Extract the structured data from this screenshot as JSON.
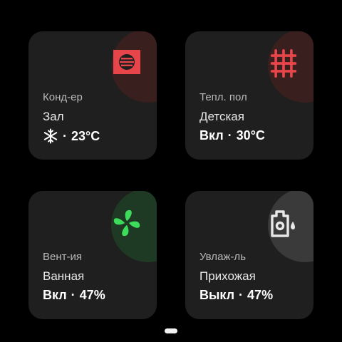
{
  "tiles": [
    {
      "type": "Конд-ер",
      "room": "Зал",
      "state_icon": "snowflake-icon",
      "separator": "·",
      "value": "23°C",
      "icon": "ac-unit-icon",
      "accent": "#e8454a"
    },
    {
      "type": "Тепл. пол",
      "room": "Детская",
      "state": "Вкл",
      "separator": "·",
      "value": "30°C",
      "icon": "floor-heating-icon",
      "accent": "#e8454a"
    },
    {
      "type": "Вент-ия",
      "room": "Ванная",
      "state": "Вкл",
      "separator": "·",
      "value": "47%",
      "icon": "fan-icon",
      "accent": "#3ddc5a"
    },
    {
      "type": "Увлаж-ль",
      "room": "Прихожая",
      "state": "Выкл",
      "separator": "·",
      "value": "47%",
      "icon": "humidifier-icon",
      "accent": "#e0e0e0"
    }
  ],
  "pager": {
    "current": 1
  }
}
